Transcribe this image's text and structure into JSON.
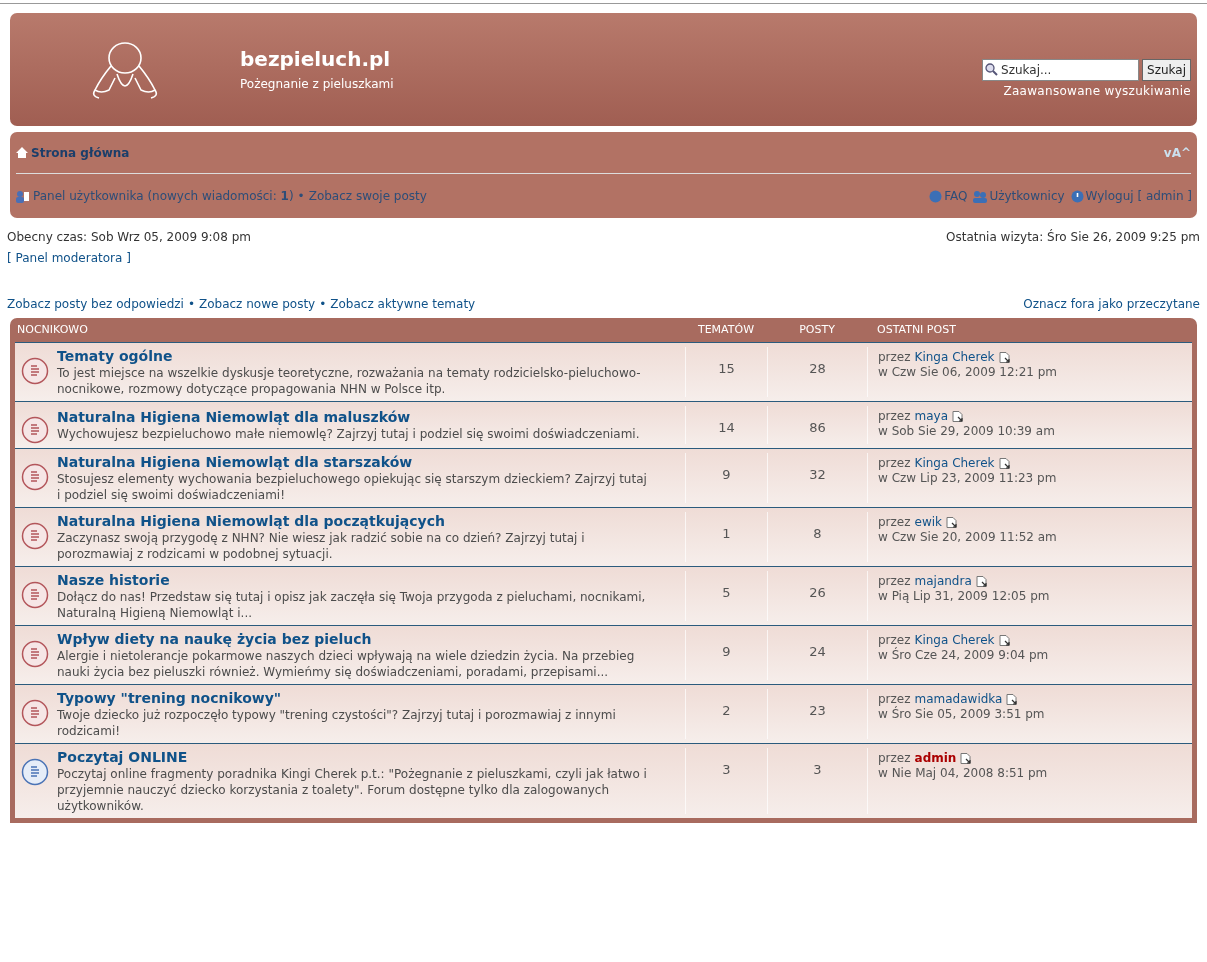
{
  "site": {
    "title": "bezpieluch.pl",
    "tagline": "Pożegnanie z pieluszkami"
  },
  "search": {
    "placeholder": "Szukaj...",
    "button": "Szukaj",
    "advanced": "Zaawansowane wyszukiwanie"
  },
  "navbar": {
    "home": "Strona główna",
    "font_toggle": "vA^",
    "user_panel": "Panel użytkownika (nowych wiadomości: **1**)",
    "separator": "•",
    "own_posts": "Zobacz swoje posty",
    "faq": "FAQ",
    "members": "Użytkownicy",
    "logout": "Wyloguj [ admin ]"
  },
  "info": {
    "current_time": "Obecny czas: Sob Wrz 05, 2009 9:08 pm",
    "last_visit": "Ostatnia wizyta: Śro Sie 26, 2009 9:25 pm",
    "mod_panel": "[ Panel moderatora ]"
  },
  "quick_links": [
    {
      "label": "Zobacz posty bez odpowiedzi"
    },
    {
      "label": "Zobacz nowe posty"
    },
    {
      "label": "Zobacz aktywne tematy"
    }
  ],
  "quick_separator": "•",
  "mark_read": "Oznacz fora jako przeczytane",
  "table": {
    "columns": [
      "NOCNIKOWO",
      "TEMATÓW",
      "POSTY",
      "OSTATNI POST"
    ],
    "rows": [
      {
        "title": "Tematy ogólne",
        "description": "To jest miejsce na wszelkie dyskusje teoretyczne, rozważania na tematy rodzicielsko-pieluchowo-nocnikowe, rozmowy dotyczące propagowania NHN w Polsce itp.",
        "unread": true,
        "topics": "15",
        "posts": "28",
        "by": "przez",
        "author": "Kinga Cherek",
        "color": "#105289",
        "date": "w Czw Sie 06, 2009 12:21 pm"
      },
      {
        "title": "Naturalna Higiena Niemowląt dla maluszków",
        "description": "Wychowujesz bezpieluchowo małe niemowlę? Zajrzyj tutaj i podziel się swoimi doświadczeniami.",
        "unread": true,
        "topics": "14",
        "posts": "86",
        "by": "przez",
        "author": "maya",
        "color": "#105289",
        "date": "w Sob Sie 29, 2009 10:39 am"
      },
      {
        "title": "Naturalna Higiena Niemowląt dla starszaków",
        "description": "Stosujesz elementy wychowania bezpieluchowego opiekując się starszym dzieckiem? Zajrzyj tutaj i podziel się swoimi doświadczeniami!",
        "unread": true,
        "topics": "9",
        "posts": "32",
        "by": "przez",
        "author": "Kinga Cherek",
        "color": "#105289",
        "date": "w Czw Lip 23, 2009 11:23 pm"
      },
      {
        "title": "Naturalna Higiena Niemowląt dla początkujących",
        "description": "Zaczynasz swoją przygodę z NHN? Nie wiesz jak radzić sobie na co dzień? Zajrzyj tutaj i porozmawiaj z rodzicami w podobnej sytuacji.",
        "unread": true,
        "topics": "1",
        "posts": "8",
        "by": "przez",
        "author": "ewik",
        "color": "#105289",
        "date": "w Czw Sie 20, 2009 11:52 am"
      },
      {
        "title": "Nasze historie",
        "description": "Dołącz do nas! Przedstaw się tutaj i opisz jak zaczęła się Twoja przygoda z pieluchami, nocnikami, Naturalną Higieną Niemowląt i...",
        "unread": true,
        "topics": "5",
        "posts": "26",
        "by": "przez",
        "author": "majandra",
        "color": "#105289",
        "date": "w Pią Lip 31, 2009 12:05 pm"
      },
      {
        "title": "Wpływ diety na naukę życia bez pieluch",
        "description": "Alergie i nietolerancje pokarmowe naszych dzieci wpływają na wiele dziedzin życia. Na przebieg nauki życia bez pieluszki również. Wymieńmy się doświadczeniami, poradami, przepisami...",
        "unread": true,
        "topics": "9",
        "posts": "24",
        "by": "przez",
        "author": "Kinga Cherek",
        "color": "#105289",
        "date": "w Śro Cze 24, 2009 9:04 pm"
      },
      {
        "title": "Typowy \"trening nocnikowy\"",
        "description": "Twoje dziecko już rozpoczęło typowy \"trening czystości\"? Zajrzyj tutaj i porozmawiaj z innymi rodzicami!",
        "unread": true,
        "topics": "2",
        "posts": "23",
        "by": "przez",
        "author": "mamadawidka",
        "color": "#105289",
        "date": "w Śro Sie 05, 2009 3:51 pm"
      },
      {
        "title": "Poczytaj ONLINE",
        "description": "Poczytaj online fragmenty poradnika Kingi Cherek p.t.: \"Pożegnanie z pieluszkami, czyli jak łatwo i przyjemnie nauczyć dziecko korzystania z toalety\". Forum dostępne tylko dla zalogowanych użytkowników.",
        "unread": false,
        "topics": "3",
        "posts": "3",
        "by": "przez",
        "author": "admin",
        "color": "#aa0000",
        "date": "w Nie Maj 04, 2008 8:51 pm"
      }
    ]
  }
}
